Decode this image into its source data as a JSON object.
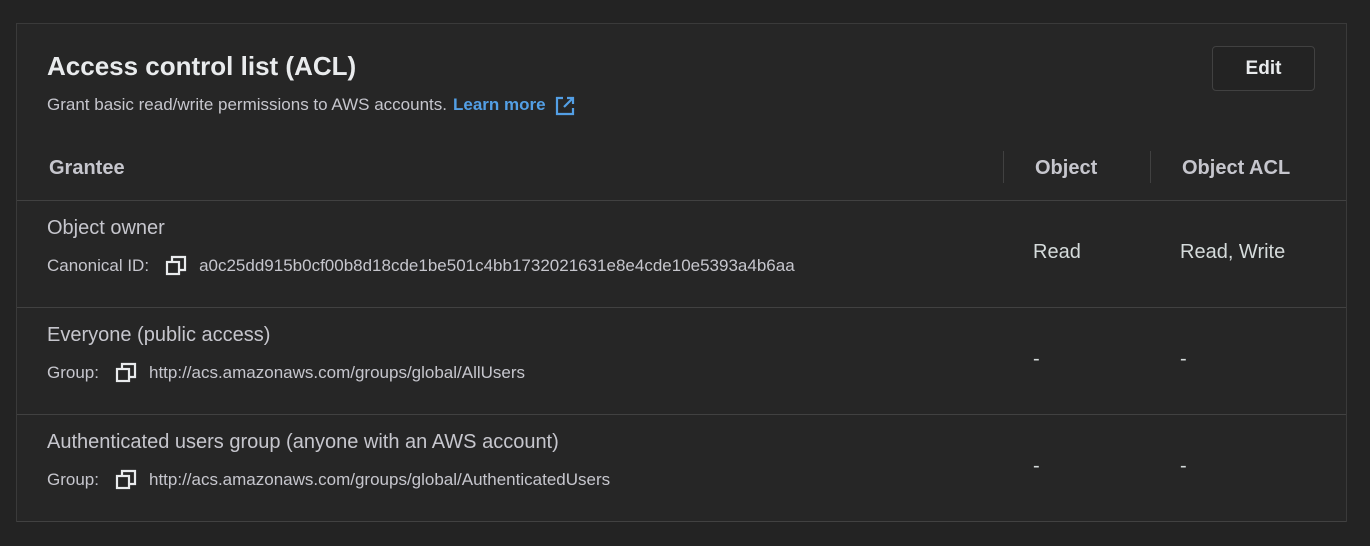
{
  "panel": {
    "title": "Access control list (ACL)",
    "description": "Grant basic read/write permissions to AWS accounts.",
    "learn_more": "Learn more",
    "edit_label": "Edit"
  },
  "table": {
    "headers": {
      "grantee": "Grantee",
      "object": "Object",
      "object_acl": "Object ACL"
    },
    "rows": [
      {
        "name": "Object owner",
        "detail_label": "Canonical ID:",
        "detail_value": "a0c25dd915b0cf00b8d18cde1be501c4bb1732021631e8e4cde10e5393a4b6aa",
        "object": "Read",
        "object_acl": "Read, Write"
      },
      {
        "name": "Everyone (public access)",
        "detail_label": "Group:",
        "detail_value": "http://acs.amazonaws.com/groups/global/AllUsers",
        "object": "-",
        "object_acl": "-"
      },
      {
        "name": "Authenticated users group (anyone with an AWS account)",
        "detail_label": "Group:",
        "detail_value": "http://acs.amazonaws.com/groups/global/AuthenticatedUsers",
        "object": "-",
        "object_acl": "-"
      }
    ]
  },
  "icons": {
    "external_link": "external-link-icon",
    "copy": "copy-icon"
  },
  "colors": {
    "link": "#539fe5",
    "background": "#232323",
    "text": "#c6c6cd"
  }
}
